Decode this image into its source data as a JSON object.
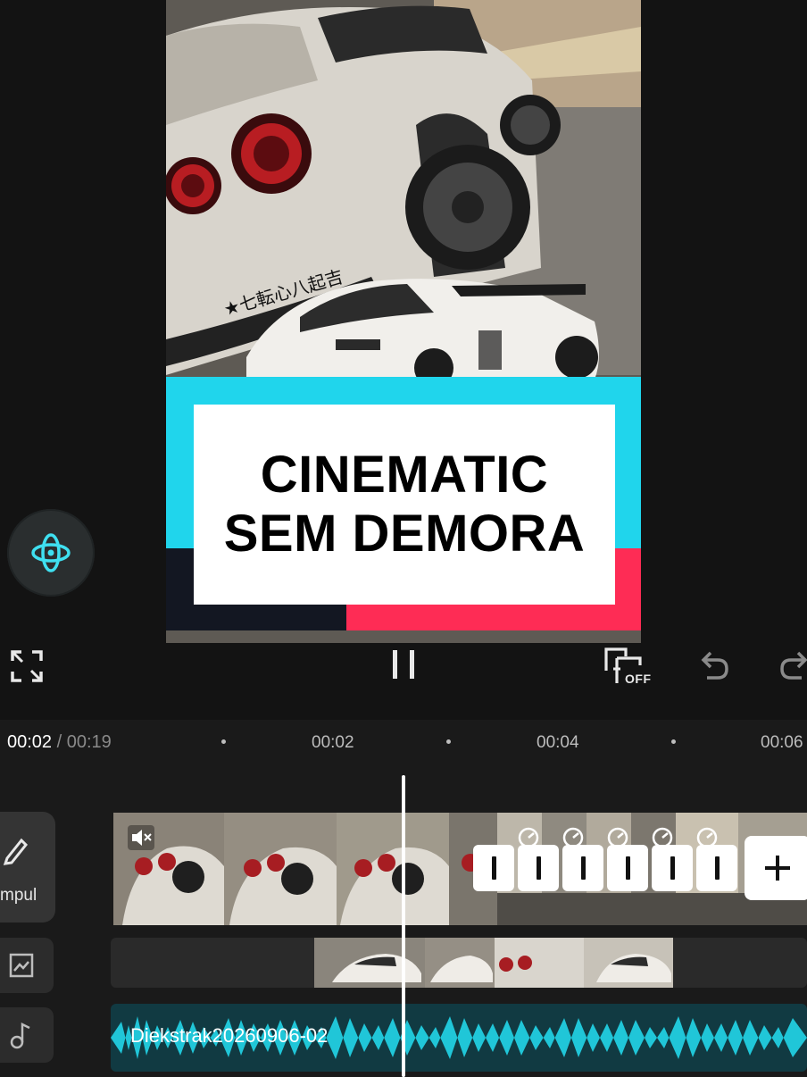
{
  "preview": {
    "title_lines": [
      "CINEMATIC",
      "SEM DEMORA"
    ],
    "decal_text": "★七転心八起吉"
  },
  "colors": {
    "cyan": "#20d5ec",
    "red": "#fe2c55",
    "dark": "#131722",
    "audio_wave": "#20c6d8"
  },
  "controls": {
    "fullscreen_icon": "fullscreen-icon",
    "play_pause_icon": "pause-icon",
    "keyframe_toggle_label": "OFF",
    "undo_icon": "undo-icon",
    "redo_icon": "redo-icon"
  },
  "timeline": {
    "current_time": "00:02",
    "total_time": " / 00:19",
    "ruler": [
      "00:02",
      "00:04",
      "00:06"
    ],
    "side_edit_label": "mpul",
    "audio_track_name": "Diekstrak20260906-02"
  }
}
